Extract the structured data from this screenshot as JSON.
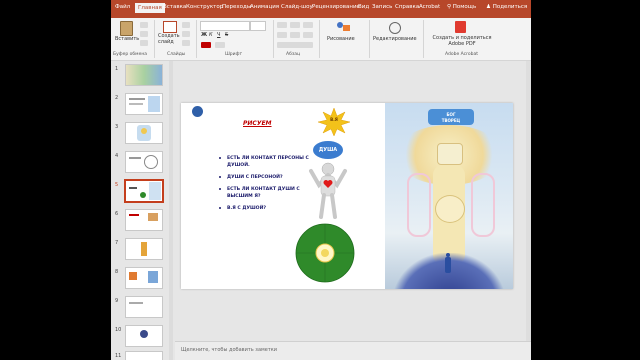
{
  "ribbon": {
    "tabs": [
      "Файл",
      "Главная",
      "Вставка",
      "Конструктор",
      "Переходы",
      "Анимация",
      "Слайд-шоу",
      "Рецензирование",
      "Вид",
      "Запись",
      "Справка",
      "Acrobat"
    ],
    "active_tab": "Главная",
    "help": "Помощь",
    "share": "Поделиться",
    "clipboard_label": "Буфер обмена",
    "paste_label": "Вставить",
    "slides_label": "Слайды",
    "new_slide_label": "Создать слайд",
    "font_label": "Шрифт",
    "paragraph_label": "Абзац",
    "drawing_label": "Рисование",
    "editing_label": "Редактирование",
    "acrobat_action": "Создать и поделиться Adobe PDF",
    "acrobat_label": "Adobe Acrobat"
  },
  "slides": {
    "numbers": [
      "1",
      "2",
      "3",
      "4",
      "5",
      "6",
      "7",
      "8",
      "9",
      "10",
      "11"
    ],
    "selected": "5"
  },
  "slide": {
    "title": "РИСУЕМ",
    "bullets": [
      "ЕСТЬ ЛИ КОНТАКТ ПЕРСОНЫ С ДУШОЙ.",
      "ДУШИ С ПЕРСОНОЙ?",
      "ЕСТЬ ЛИ КОНТАКТ ДУШИ С ВЫСШИМ Я?",
      "В.Я С ДУШОЙ?"
    ],
    "sun_label": "В.Я",
    "soul_label": "ДУША",
    "banner_top": "БОГ",
    "banner_bottom": "ТВОРЕЦ"
  },
  "notes_placeholder": "Щелкните, чтобы добавить заметки",
  "colors": {
    "ribbon": "#b7472a",
    "title": "#c00000",
    "soul": "#3b7ccf",
    "earth": "#2f8a2a"
  },
  "icons": [
    "search-icon",
    "share-icon",
    "paste-icon",
    "new-slide-icon",
    "drawing-icon",
    "editing-icon",
    "acrobat-icon",
    "sun-icon",
    "heart-icon"
  ]
}
